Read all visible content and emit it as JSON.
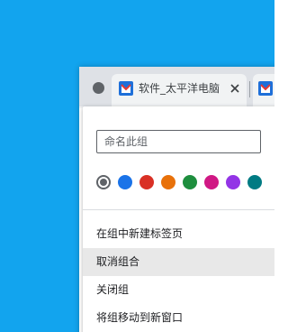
{
  "tabstrip": {
    "tabs": [
      {
        "title": "软件_太平洋电脑",
        "favicon": "pconline-favicon-icon"
      },
      {
        "title": "",
        "favicon": "pconline-favicon-icon"
      }
    ],
    "close_icon": "close-icon"
  },
  "group_editor": {
    "name_placeholder": "命名此组",
    "name_value": "",
    "colors": [
      "#5f6368",
      "#1a73e8",
      "#d93025",
      "#e8710a",
      "#1e8e3e",
      "#d01884",
      "#9334e6",
      "#007b83"
    ],
    "selected_color_index": 0
  },
  "menu": {
    "items": [
      {
        "label": "在组中新建标签页"
      },
      {
        "label": "取消组合"
      },
      {
        "label": "关闭组"
      },
      {
        "label": "将组移动到新窗口"
      }
    ],
    "hovered_index": 1
  }
}
